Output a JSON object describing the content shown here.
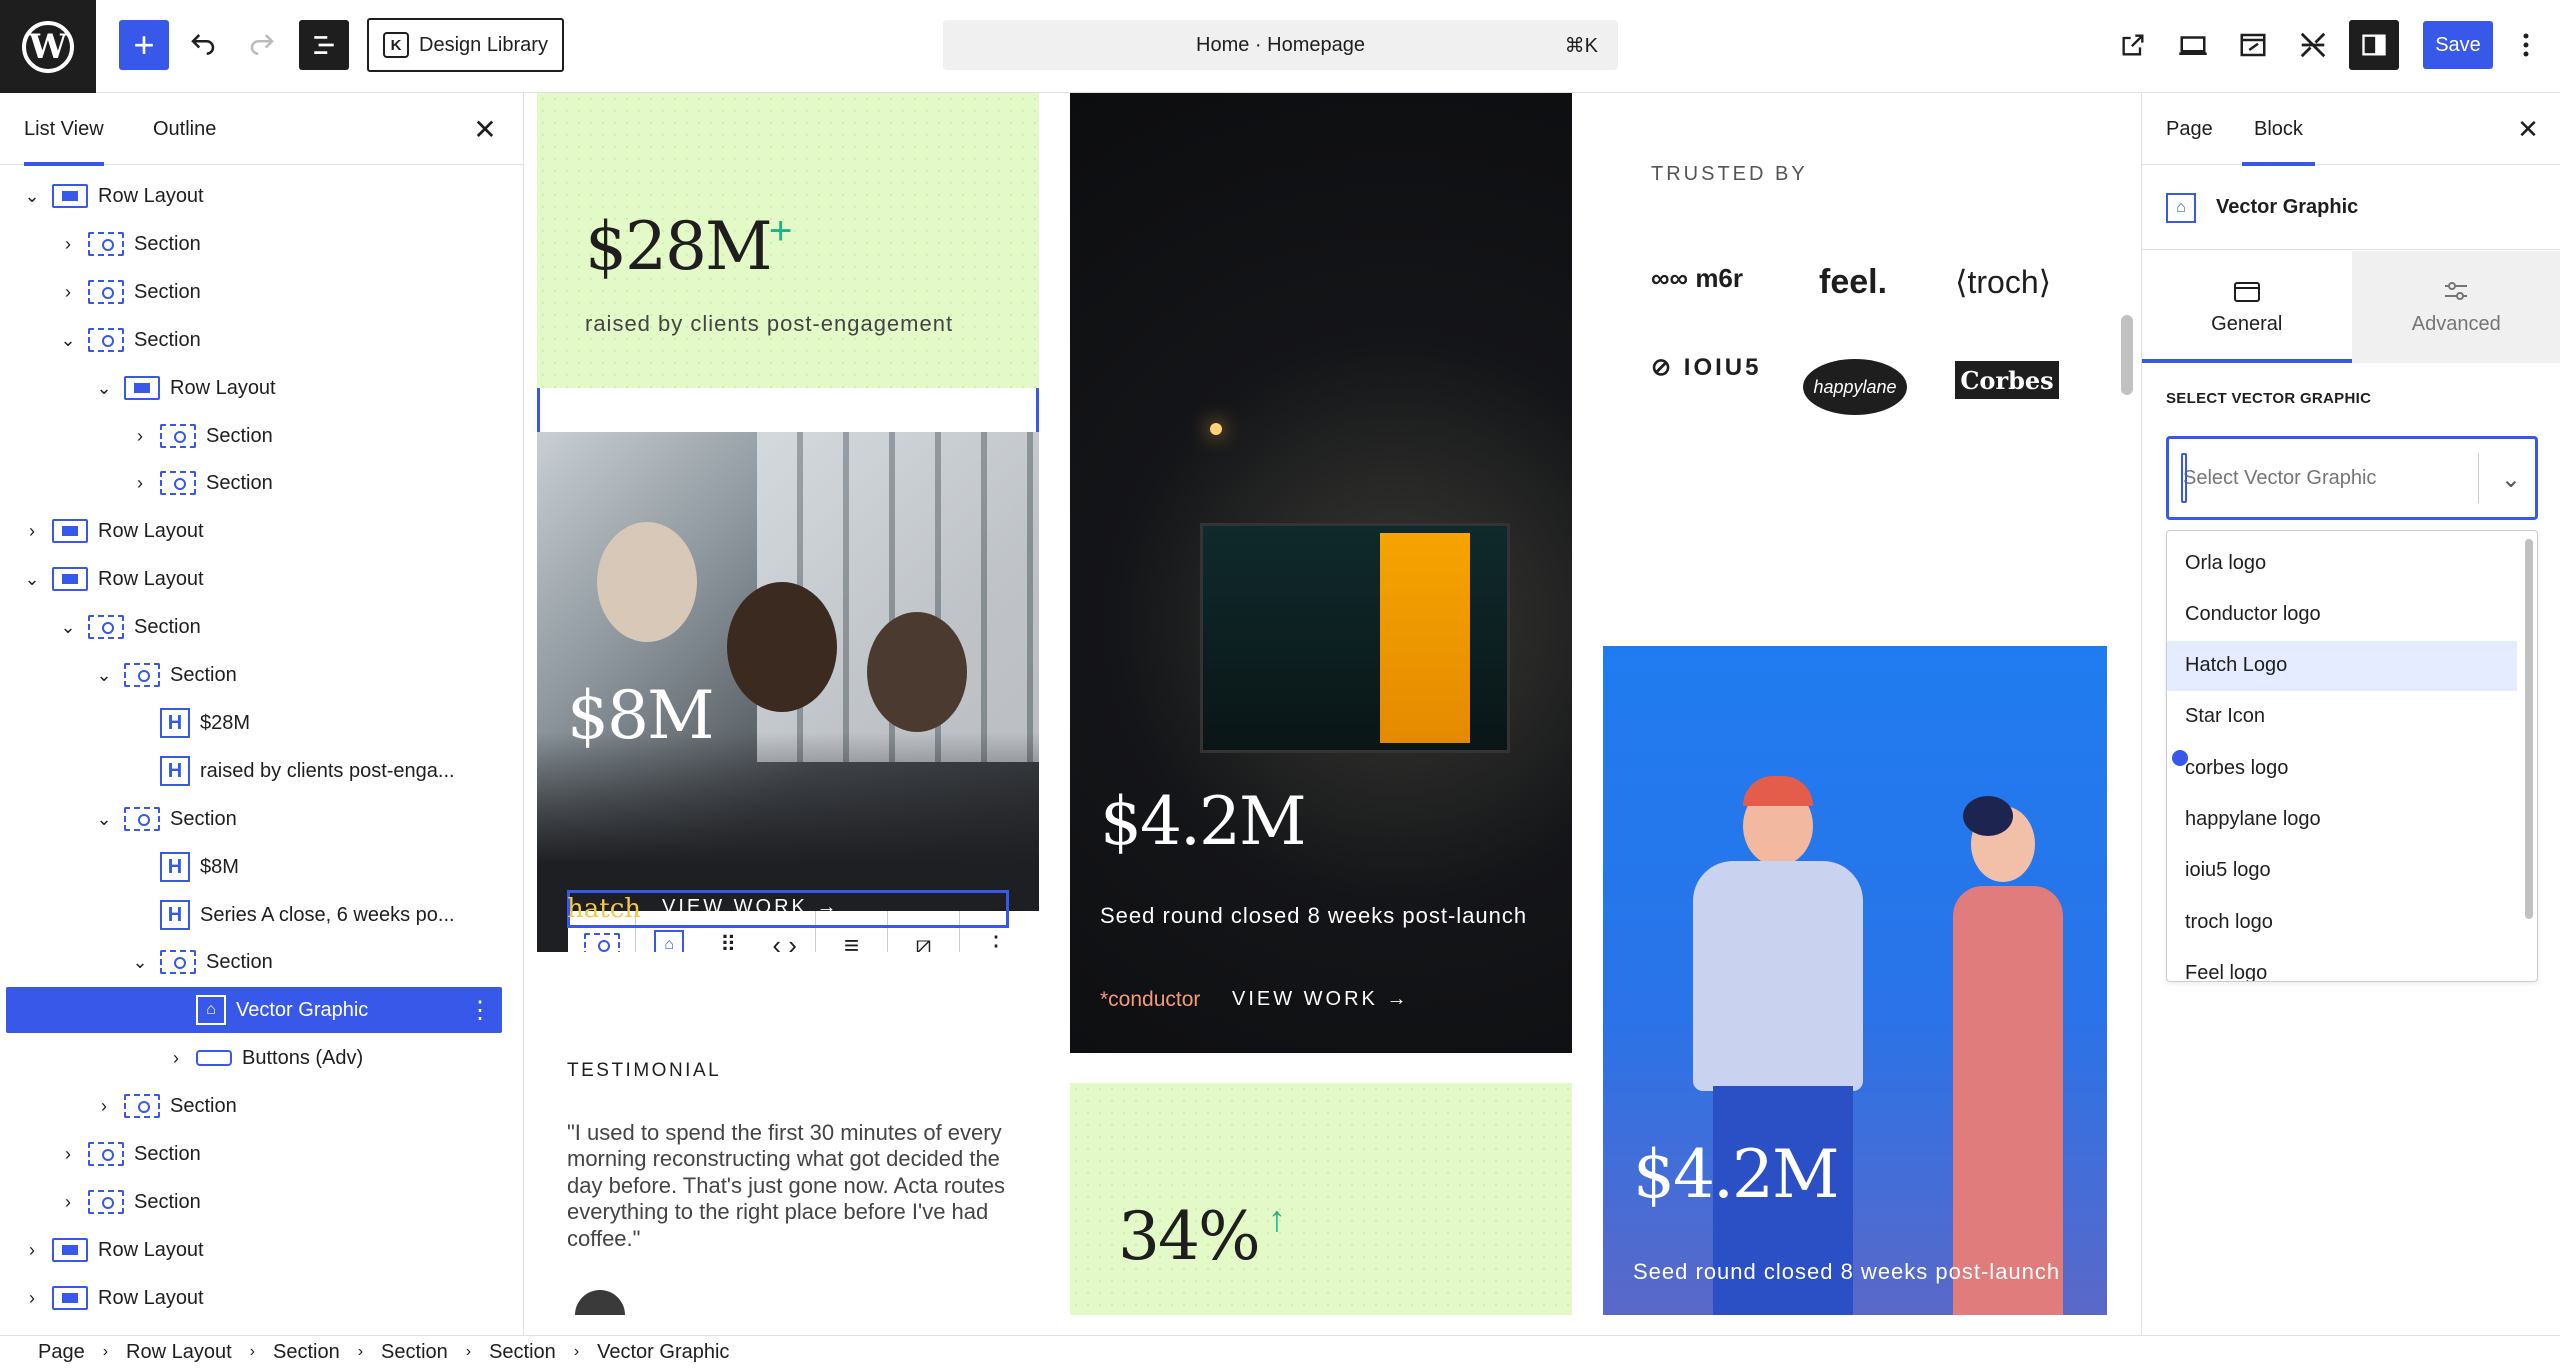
{
  "topbar": {
    "wp_logo": "W",
    "add_icon": "+",
    "design_library_label": "Design Library",
    "design_library_icon": "K",
    "command_bar_title": "Home · Homepage",
    "command_shortcut": "⌘K",
    "save_label": "Save"
  },
  "left_sidebar": {
    "tabs": [
      "List View",
      "Outline"
    ],
    "rows": [
      {
        "label": "Row Layout",
        "type": "row",
        "depth": 0,
        "chevron": "down"
      },
      {
        "label": "Section",
        "type": "section",
        "depth": 1,
        "chevron": "right"
      },
      {
        "label": "Section",
        "type": "section",
        "depth": 1,
        "chevron": "right"
      },
      {
        "label": "Section",
        "type": "section",
        "depth": 1,
        "chevron": "down"
      },
      {
        "label": "Row Layout",
        "type": "row",
        "depth": 2,
        "chevron": "down"
      },
      {
        "label": "Section",
        "type": "section",
        "depth": 3,
        "chevron": "right"
      },
      {
        "label": "Section",
        "type": "section",
        "depth": 3,
        "chevron": "right"
      },
      {
        "label": "Row Layout",
        "type": "row",
        "depth": 0,
        "chevron": "right"
      },
      {
        "label": "Row Layout",
        "type": "row",
        "depth": 0,
        "chevron": "down"
      },
      {
        "label": "Section",
        "type": "section",
        "depth": 1,
        "chevron": "down"
      },
      {
        "label": "Section",
        "type": "section",
        "depth": 2,
        "chevron": "down"
      },
      {
        "label": "$28M",
        "type": "heading",
        "depth": 3,
        "chevron": ""
      },
      {
        "label": "raised by clients post-enga...",
        "type": "heading",
        "depth": 3,
        "chevron": ""
      },
      {
        "label": "Section",
        "type": "section",
        "depth": 2,
        "chevron": "down"
      },
      {
        "label": "$8M",
        "type": "heading",
        "depth": 3,
        "chevron": ""
      },
      {
        "label": "Series A close, 6 weeks po...",
        "type": "heading",
        "depth": 3,
        "chevron": ""
      },
      {
        "label": "Section",
        "type": "section",
        "depth": 3,
        "chevron": "down"
      },
      {
        "label": "Vector Graphic",
        "type": "vector",
        "depth": 4,
        "chevron": "",
        "selected": true
      },
      {
        "label": "Buttons (Adv)",
        "type": "buttons",
        "depth": 4,
        "chevron": "right"
      },
      {
        "label": "Section",
        "type": "section",
        "depth": 2,
        "chevron": "right"
      },
      {
        "label": "Section",
        "type": "section",
        "depth": 1,
        "chevron": "right"
      },
      {
        "label": "Section",
        "type": "section",
        "depth": 1,
        "chevron": "right"
      },
      {
        "label": "Row Layout",
        "type": "row",
        "depth": 0,
        "chevron": "right"
      },
      {
        "label": "Row Layout",
        "type": "row",
        "depth": 0,
        "chevron": "right"
      }
    ]
  },
  "canvas": {
    "stat1": {
      "value": "$28M",
      "plus": "+",
      "caption": "raised by clients post-engagement"
    },
    "stat2": {
      "value": "$8M",
      "logo": "hatch",
      "cta": "VIEW WORK"
    },
    "stat3": {
      "value": "$4.2M",
      "caption": "Seed round closed 8 weeks post-launch",
      "logo": "*conductor",
      "cta": "VIEW WORK"
    },
    "stat4": {
      "value": "34%"
    },
    "stat5": {
      "value": "$4.2M",
      "caption": "Seed round closed 8 weeks post-launch"
    },
    "trusted": {
      "heading": "TRUSTED BY",
      "logos": [
        "m6r",
        "feel.",
        "troch",
        "IOIU5",
        "happylane",
        "Corbes"
      ]
    },
    "testimonial": {
      "heading": "TESTIMONIAL",
      "quote": "\"I used to spend the first 30 minutes of every morning reconstructing what got decided the day before. That's just gone now. Acta routes everything to the right place before I've had coffee.\""
    },
    "colors": {
      "mint": "#e3f9c7",
      "accent_green": "#1db588",
      "blue": "#1f7cf0",
      "highlight": "#3858e9"
    }
  },
  "right_sidebar": {
    "tabs": [
      "Page",
      "Block"
    ],
    "block_name": "Vector Graphic",
    "sub_tabs": [
      "General",
      "Advanced"
    ],
    "field_label": "SELECT VECTOR GRAPHIC",
    "select_placeholder": "Select Vector Graphic",
    "options": [
      "Orla logo",
      "Conductor logo",
      "Hatch Logo",
      "Star Icon",
      "corbes logo",
      "happylane logo",
      "ioiu5 logo",
      "troch logo",
      "Feel logo"
    ],
    "highlighted_option": "Hatch Logo"
  },
  "footer": {
    "breadcrumbs": [
      "Page",
      "Row Layout",
      "Section",
      "Section",
      "Section",
      "Vector Graphic"
    ]
  }
}
